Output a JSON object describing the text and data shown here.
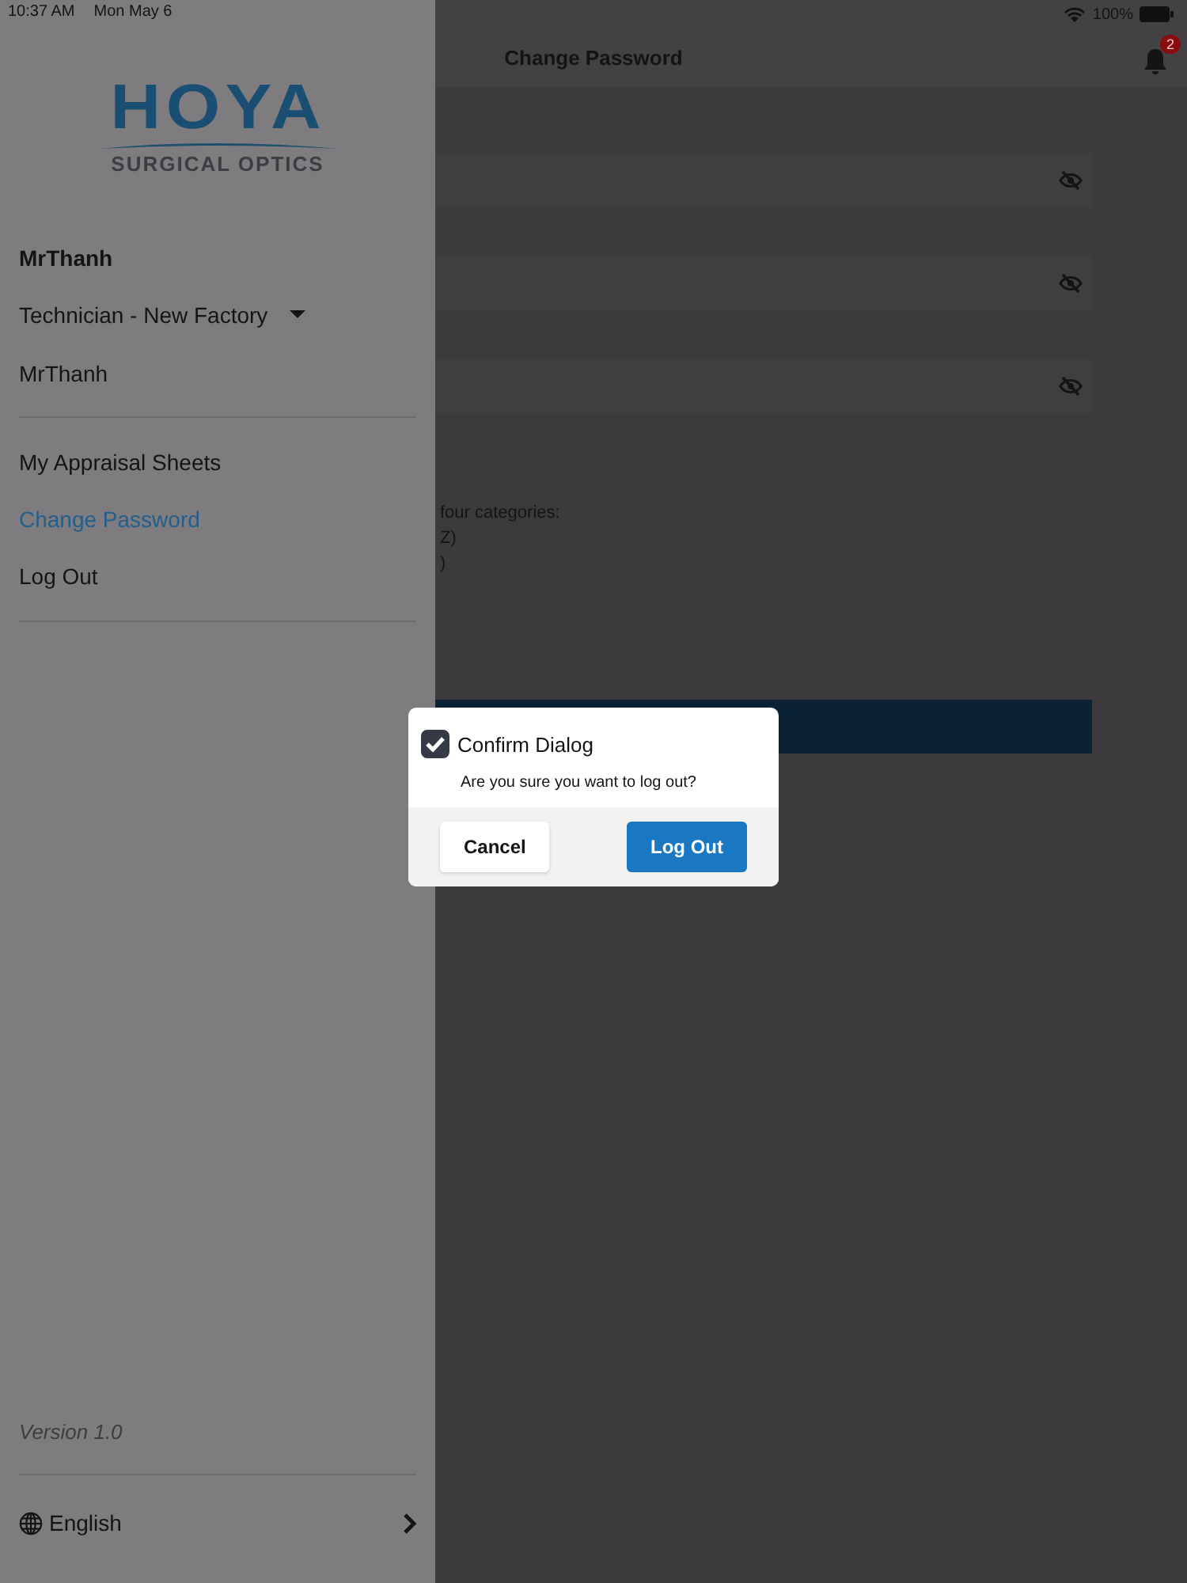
{
  "status_bar": {
    "time": "10:37 AM",
    "date": "Mon May 6",
    "battery": "100%"
  },
  "page": {
    "title": "Change Password",
    "notification_count": "2",
    "password_fields": [
      {
        "masked": true
      },
      {
        "masked": true
      },
      {
        "masked": true
      }
    ],
    "hint_lines": [
      "four categories:",
      "Z)",
      ")"
    ]
  },
  "drawer": {
    "logo": {
      "name": "HOYA",
      "tagline": "SURGICAL OPTICS"
    },
    "user_name": "MrThanh",
    "role": "Technician - New Factory",
    "username": "MrThanh",
    "menu": [
      {
        "label": "My Appraisal Sheets",
        "selected": false
      },
      {
        "label": "Change Password",
        "selected": true
      },
      {
        "label": "Log Out",
        "selected": false
      }
    ],
    "version": "Version 1.0",
    "language": "English"
  },
  "dialog": {
    "title": "Confirm Dialog",
    "checked": true,
    "message": "Are you sure you want to log out?",
    "buttons": [
      {
        "label": "Cancel",
        "kind": "secondary"
      },
      {
        "label": "Log Out",
        "kind": "primary"
      }
    ]
  }
}
